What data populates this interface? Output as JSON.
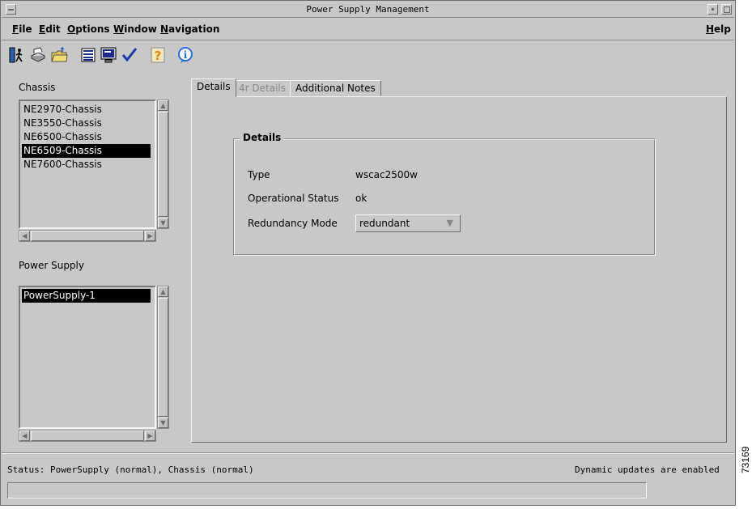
{
  "window": {
    "title": "Power Supply Management"
  },
  "menu": {
    "file": {
      "mnemonic": "F",
      "rest": "ile"
    },
    "edit": {
      "mnemonic": "E",
      "rest": "dit"
    },
    "options": {
      "mnemonic": "O",
      "rest": "ptions"
    },
    "window": {
      "mnemonic": "W",
      "rest": "indow"
    },
    "navigation": {
      "mnemonic": "N",
      "rest": "avigation"
    },
    "help": {
      "mnemonic": "H",
      "rest": "elp"
    }
  },
  "toolbar": {
    "icons": [
      "exit-icon",
      "print-icon",
      "open-folder-icon",
      "list-icon",
      "monitor-icon",
      "check-icon",
      "help-icon",
      "info-icon"
    ],
    "help_glyph": "?",
    "info_glyph": "i"
  },
  "chassis": {
    "label": "Chassis",
    "items": [
      {
        "label": "NE2970-Chassis",
        "selected": false
      },
      {
        "label": "NE3550-Chassis",
        "selected": false
      },
      {
        "label": "NE6500-Chassis",
        "selected": false
      },
      {
        "label": "NE6509-Chassis",
        "selected": true
      },
      {
        "label": "NE7600-Chassis",
        "selected": false
      }
    ]
  },
  "power_supply": {
    "label": "Power Supply",
    "items": [
      {
        "label": "PowerSupply-1",
        "selected": true
      }
    ]
  },
  "tabs": [
    {
      "label": "Details",
      "active": true,
      "enabled": true
    },
    {
      "label": "4r Details",
      "active": false,
      "enabled": false
    },
    {
      "label": "Additional Notes",
      "active": false,
      "enabled": true
    }
  ],
  "details": {
    "group_title": "Details",
    "type_label": "Type",
    "type_value": "wscac2500w",
    "op_status_label": "Operational Status",
    "op_status_value": "ok",
    "redundancy_label": "Redundancy Mode",
    "redundancy_value": "redundant"
  },
  "status": {
    "text": "Status: PowerSupply (normal), Chassis (normal)",
    "updates": "Dynamic updates are enabled"
  },
  "figure_id": "73169",
  "colors": {
    "window_bg": "#c8c8c8",
    "selection_bg": "#000000",
    "selection_fg": "#ffffff",
    "help_icon": "#e08a00",
    "info_icon": "#2a6fd6"
  }
}
